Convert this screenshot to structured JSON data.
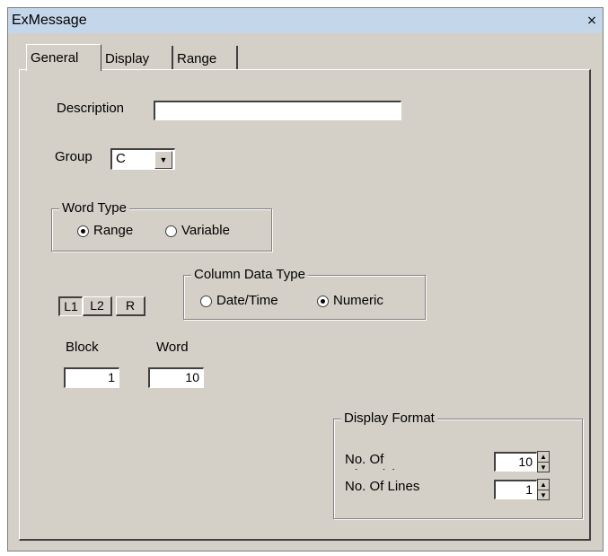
{
  "window": {
    "title": "ExMessage",
    "close": "×"
  },
  "tabs": [
    "General",
    "Display",
    "Range"
  ],
  "general": {
    "description_label": "Description",
    "description_value": "",
    "group_label": "Group",
    "group_value": "C",
    "word_type": {
      "legend": "Word Type",
      "options": [
        "Range",
        "Variable"
      ],
      "selected": "Range"
    },
    "column_data_type": {
      "legend": "Column Data Type",
      "options": [
        "Date/Time",
        "Numeric"
      ],
      "selected": "Numeric"
    },
    "position_buttons": [
      "L1",
      "L2",
      "R"
    ],
    "block_label": "Block",
    "block_value": "1",
    "word_label": "Word",
    "word_value": "10",
    "display_format": {
      "legend": "Display Format",
      "chars_label": "No. Of Chars/Line",
      "chars_value": "10",
      "lines_label": "No. Of Lines",
      "lines_value": "1"
    }
  },
  "icons": {
    "dropdown": "▼",
    "spin_up": "▲",
    "spin_down": "▼"
  }
}
